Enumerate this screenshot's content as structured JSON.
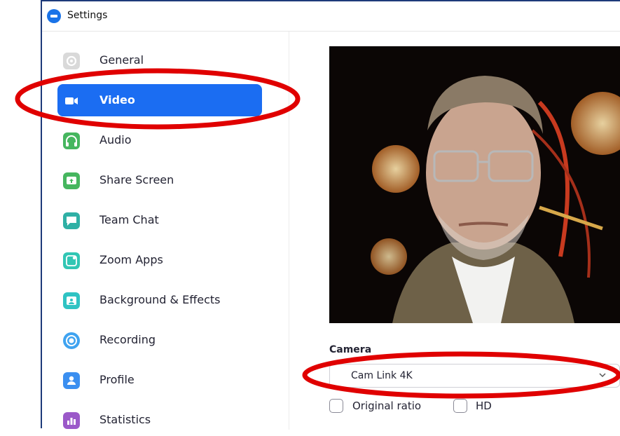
{
  "window": {
    "title": "Settings"
  },
  "sidebar": {
    "items": [
      {
        "label": "General",
        "icon": "gear-icon",
        "color": "#d6d6d6",
        "active": false
      },
      {
        "label": "Video",
        "icon": "video-camera-icon",
        "color": "#ffffff",
        "active": true
      },
      {
        "label": "Audio",
        "icon": "headphones-icon",
        "color": "#46b65f",
        "active": false
      },
      {
        "label": "Share Screen",
        "icon": "share-screen-icon",
        "color": "#46b65f",
        "active": false
      },
      {
        "label": "Team Chat",
        "icon": "chat-bubble-icon",
        "color": "#2fb0a5",
        "active": false
      },
      {
        "label": "Zoom Apps",
        "icon": "apps-icon",
        "color": "#31c6b4",
        "active": false
      },
      {
        "label": "Background & Effects",
        "icon": "background-icon",
        "color": "#2fc3c3",
        "active": false
      },
      {
        "label": "Recording",
        "icon": "record-icon",
        "color": "#3fa3f0",
        "active": false
      },
      {
        "label": "Profile",
        "icon": "profile-icon",
        "color": "#3b8ff0",
        "active": false
      },
      {
        "label": "Statistics",
        "icon": "statistics-icon",
        "color": "#9b59c9",
        "active": false
      }
    ]
  },
  "video": {
    "camera_label": "Camera",
    "camera_value": "Cam Link 4K",
    "original_ratio_label": "Original ratio",
    "hd_label": "HD"
  },
  "colors": {
    "accent": "#1b6df2",
    "annotation": "#e00000"
  }
}
